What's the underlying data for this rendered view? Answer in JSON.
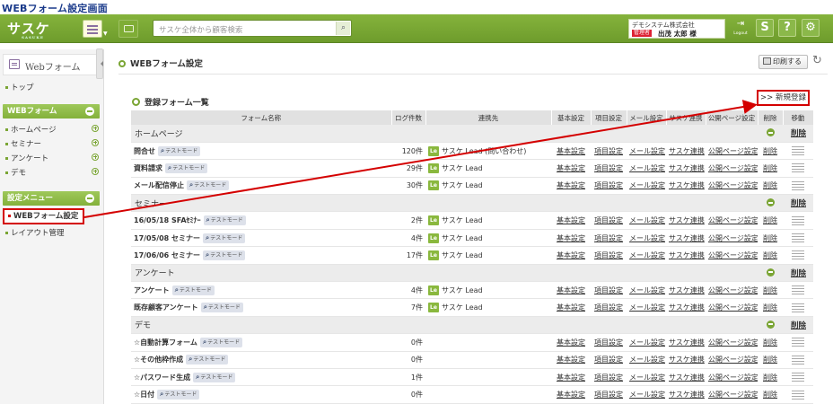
{
  "caption": "WEBフォーム設定画面",
  "header": {
    "logo": "サスケ",
    "logo_sub": "SASUKE",
    "search_placeholder": "サスケ全体から顧客検索",
    "company": "デモシステム株式会社",
    "badge": "管理者",
    "user": "出茂 太郎 様",
    "logout": "Logout",
    "help": "?"
  },
  "sidebar": {
    "title": "Webフォーム",
    "top": "トップ",
    "section1": "WEBフォーム",
    "items": [
      "ホームページ",
      "セミナー",
      "アンケート",
      "デモ"
    ],
    "section2": "設定メニュー",
    "selected": "WEBフォーム設定",
    "layout": "レイアウト管理"
  },
  "main": {
    "page_title": "WEBフォーム設定",
    "print": "印刷する",
    "list_title": "登録フォーム一覧",
    "new_button": ">> 新規登録",
    "test_mode": "テストモード",
    "le_icon": "Le",
    "link_labels": [
      "基本設定",
      "項目設定",
      "メール設定",
      "サスケ連携",
      "公開ページ設定"
    ],
    "delete_label": "削除",
    "bulk_delete": "削除"
  },
  "table": {
    "headers": [
      "フォーム名称",
      "ログ件数",
      "連携先",
      "基本設定",
      "項目設定",
      "メール設定",
      "サスケ連携",
      "公開ページ設定",
      "削除",
      "移動"
    ],
    "groups": [
      {
        "name": "ホームページ",
        "rows": [
          {
            "name": "問合せ",
            "count": "120件",
            "link": "サスケ Lead (問い合わせ)"
          },
          {
            "name": "資料請求",
            "count": "29件",
            "link": "サスケ Lead"
          },
          {
            "name": "メール配信停止",
            "count": "30件",
            "link": "サスケ Lead"
          }
        ]
      },
      {
        "name": "セミナー",
        "rows": [
          {
            "name": "16/05/18 SFAｾﾐﾅｰ",
            "count": "2件",
            "link": "サスケ Lead"
          },
          {
            "name": "17/05/08 セミナー",
            "count": "4件",
            "link": "サスケ Lead"
          },
          {
            "name": "17/06/06 セミナー",
            "count": "17件",
            "link": "サスケ Lead"
          }
        ]
      },
      {
        "name": "アンケート",
        "rows": [
          {
            "name": "アンケート",
            "count": "4件",
            "link": "サスケ Lead"
          },
          {
            "name": "既存顧客アンケート",
            "count": "7件",
            "link": "サスケ Lead"
          }
        ]
      },
      {
        "name": "デモ",
        "rows": [
          {
            "name": "☆自動計算フォーム",
            "count": "0件",
            "link": ""
          },
          {
            "name": "☆その他枠作成",
            "count": "0件",
            "link": ""
          },
          {
            "name": "☆パスワード生成",
            "count": "1件",
            "link": ""
          },
          {
            "name": "☆日付",
            "count": "0件",
            "link": ""
          }
        ]
      }
    ]
  },
  "colors": {
    "brand": "#7aa534",
    "annotation": "#d40000",
    "caption": "#1a3a8a"
  }
}
